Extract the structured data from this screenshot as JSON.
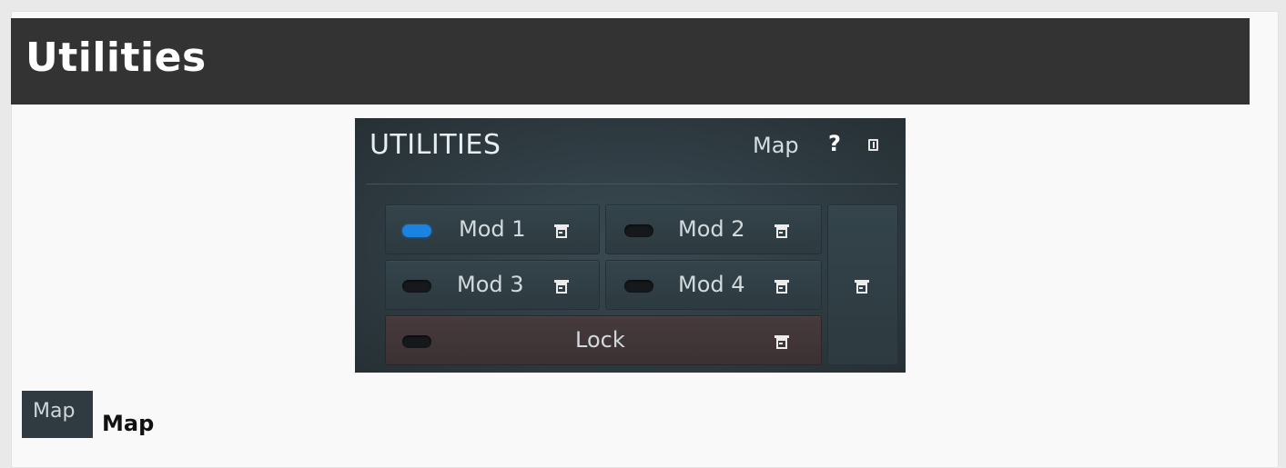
{
  "header": {
    "title": "Utilities"
  },
  "panel": {
    "title": "UTILITIES",
    "map_label": "Map",
    "help_label": "?",
    "buttons": [
      {
        "label": "Mod 1",
        "active": true
      },
      {
        "label": "Mod 2",
        "active": false
      },
      {
        "label": "Mod 3",
        "active": false
      },
      {
        "label": "Mod 4",
        "active": false
      }
    ],
    "lock": {
      "label": "Lock",
      "active": false
    }
  },
  "section": {
    "chip_label": "Map",
    "heading": "Map"
  },
  "colors": {
    "led_on": "#1a82e0",
    "header_bg": "#333333",
    "panel_bg": "#2c383e"
  },
  "icons": [
    "menu-icon",
    "help-icon",
    "collapse-icon"
  ]
}
